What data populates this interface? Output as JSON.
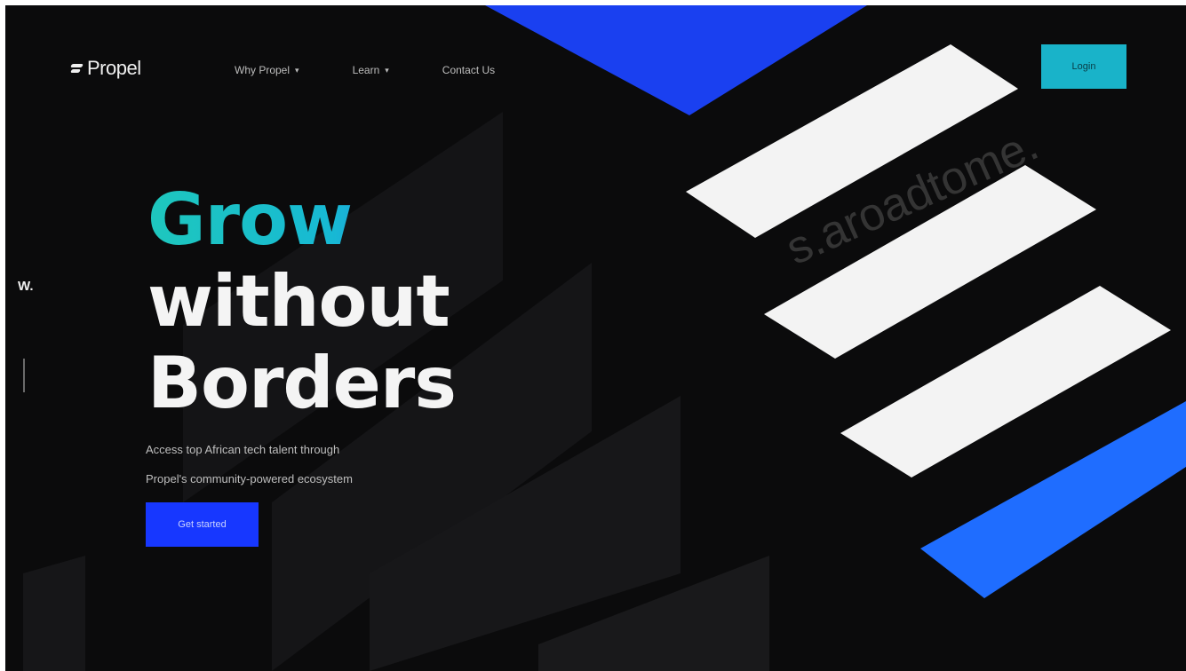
{
  "logo": {
    "text": "Propel"
  },
  "nav": {
    "items": [
      {
        "label": "Why Propel",
        "has_dropdown": true
      },
      {
        "label": "Learn",
        "has_dropdown": true
      },
      {
        "label": "Contact Us",
        "has_dropdown": false
      }
    ],
    "button_label": "Login"
  },
  "hero": {
    "line1": "Grow",
    "line2": "without",
    "line3": "Borders",
    "subtitle_line1": "Access top African tech talent through",
    "subtitle_line2": "Propel's community-powered ecosystem",
    "cta_label": "Get started"
  },
  "side": {
    "letter": "W."
  },
  "watermark": {
    "text": "s.aroadtome."
  },
  "colors": {
    "background": "#0b0b0c",
    "accent_teal": "#19b3c9",
    "accent_blue": "#1737ff",
    "shape_blue": "#1f6dff",
    "shape_white": "#f3f3f3"
  },
  "icons": {
    "logo_mark": "propel-logo-icon",
    "dropdown": "chevron-down-icon"
  }
}
